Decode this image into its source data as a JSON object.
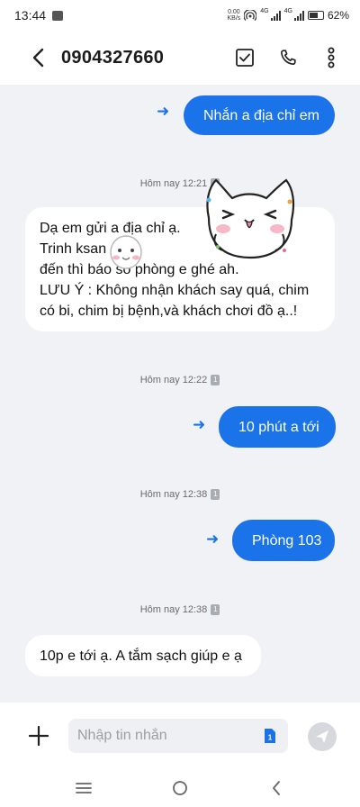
{
  "status_bar": {
    "time": "13:44",
    "net_speed_value": "0.00",
    "net_speed_unit": "KB/s",
    "sim1_network": "4G",
    "sim2_network": "4G",
    "battery": "62%",
    "battery_level": 0.62
  },
  "header": {
    "contact": "0904327660"
  },
  "messages": [
    {
      "direction": "out",
      "text": "Nhắn a địa chỉ em"
    },
    {
      "direction": "stamp",
      "text": "Hôm nay 12:21",
      "sim": "1"
    },
    {
      "direction": "in",
      "lines": [
        "Dạ em gửi a địa chỉ ạ.",
        "Trinh ksan",
        "đến thì báo số phòng e ghé ah.",
        "LƯU Ý : Không nhận khách say quá, chim",
        "có bi, chim bị bệnh,và khách chơi đồ ạ..!"
      ]
    },
    {
      "direction": "stamp",
      "text": "Hôm nay 12:22",
      "sim": "1"
    },
    {
      "direction": "out",
      "text": "10 phút a tới"
    },
    {
      "direction": "stamp",
      "text": "Hôm nay 12:38",
      "sim": "1"
    },
    {
      "direction": "out",
      "text": "Phòng 103"
    },
    {
      "direction": "stamp",
      "text": "Hôm nay 12:38",
      "sim": "1"
    },
    {
      "direction": "in",
      "text": "10p e tới ạ. A tắm sạch giúp e ạ"
    }
  ],
  "composer": {
    "placeholder": "Nhập tin nhắn",
    "sim_slot": "1"
  },
  "colors": {
    "accent": "#1a73e8",
    "background": "#f1f2f6",
    "incoming_bubble": "#ffffff"
  },
  "icons": {
    "back": "chevron-left-icon",
    "select": "checkbox-icon",
    "call": "phone-icon",
    "more": "more-vertical-icon",
    "attach": "plus-icon",
    "send": "send-icon",
    "nav_recents": "menu-lines-icon",
    "nav_home": "circle-home-icon",
    "nav_back": "chevron-back-icon"
  }
}
